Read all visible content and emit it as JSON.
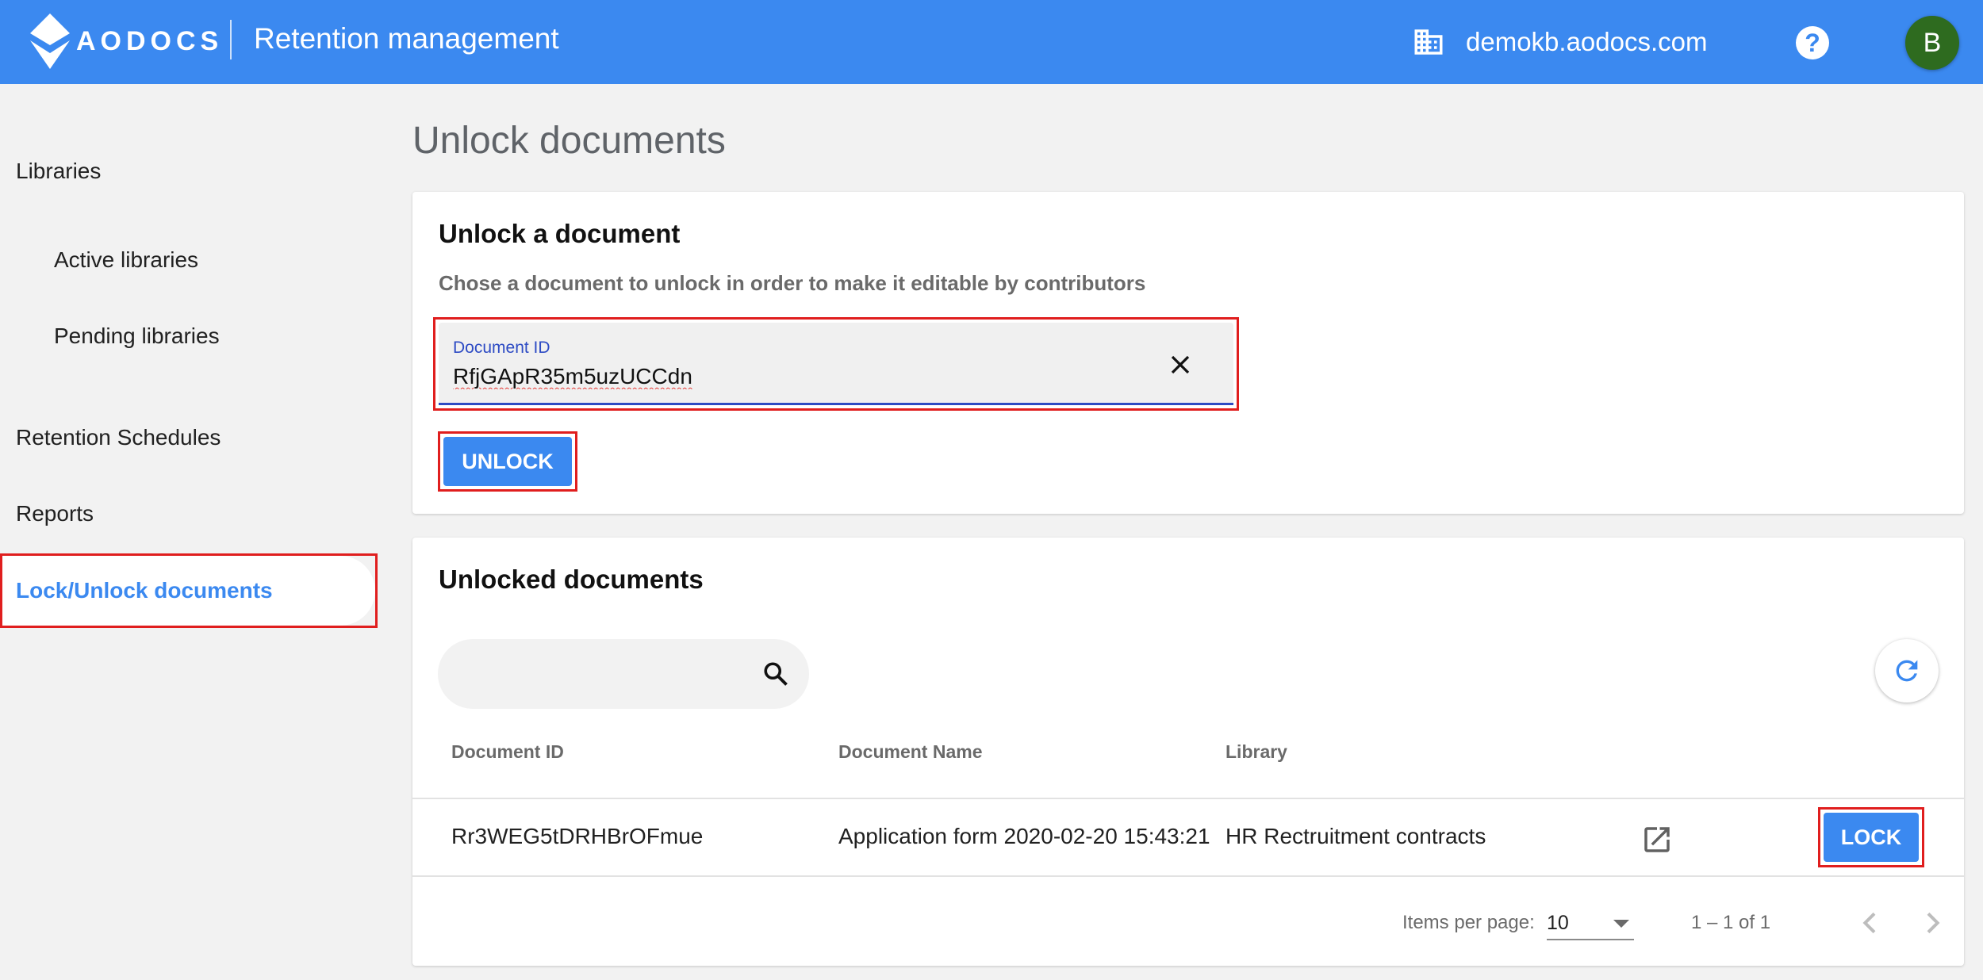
{
  "header": {
    "logo_text": "AODOCS",
    "app_title": "Retention management",
    "domain": "demokb.aodocs.com",
    "help_icon": "help-circle-icon",
    "avatar_letter": "B",
    "brand_color": "#3b89f0"
  },
  "sidebar": {
    "items": [
      {
        "label": "Libraries"
      },
      {
        "label": "Active libraries"
      },
      {
        "label": "Pending libraries"
      },
      {
        "label": "Retention Schedules"
      },
      {
        "label": "Reports"
      },
      {
        "label": "Lock/Unlock documents"
      }
    ]
  },
  "main": {
    "page_title": "Unlock documents",
    "unlock_card": {
      "title": "Unlock a document",
      "subtitle": "Chose a document to unlock in order to make it editable by contributors",
      "field_label": "Document ID",
      "field_value": "RfjGApR35m5uzUCCdn",
      "unlock_label": "UNLOCK"
    },
    "unlocked_card": {
      "title": "Unlocked documents",
      "columns": [
        "Document ID",
        "Document Name",
        "Library"
      ],
      "rows": [
        {
          "doc_id": "Rr3WEG5tDRHBrOFmue",
          "doc_name": "Application form 2020-02-20 15:43:21",
          "library": "HR Rectruitment contracts",
          "action_label": "LOCK"
        }
      ],
      "items_per_page_label": "Items per page:",
      "items_per_page_value": "10",
      "range_label": "1 – 1 of 1"
    }
  }
}
